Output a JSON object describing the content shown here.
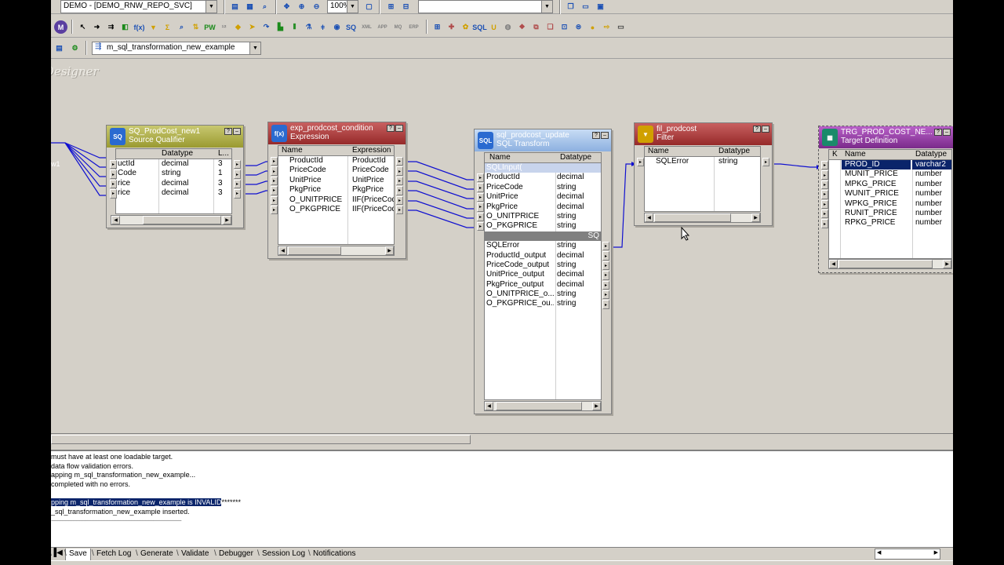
{
  "toolbar": {
    "repo_combo": "DEMO - [DEMO_RNW_REPO_SVC]",
    "zoom": "100%",
    "mapping_combo": "m_sql_transformation_new_example"
  },
  "canvas": {
    "designer_label": "Designer",
    "link_label": "w1"
  },
  "sq": {
    "title": "SQ_ProdCost_new1",
    "subtitle": "Source Qualifier",
    "headers": [
      "",
      "Datatype",
      "L..."
    ],
    "rows": [
      [
        "uctId",
        "decimal",
        "3"
      ],
      [
        "Code",
        "string",
        "1"
      ],
      [
        "rice",
        "decimal",
        "3"
      ],
      [
        "rice",
        "decimal",
        "3"
      ]
    ]
  },
  "exp": {
    "title": "exp_prodcost_condition",
    "subtitle": "Expression",
    "headers": [
      "Name",
      "Expression"
    ],
    "rows": [
      [
        "ProductId",
        "ProductId"
      ],
      [
        "PriceCode",
        "PriceCode"
      ],
      [
        "UnitPrice",
        "UnitPrice"
      ],
      [
        "PkgPrice",
        "PkgPrice"
      ],
      [
        "O_UNITPRICE",
        "IIF(PriceCode"
      ],
      [
        "O_PKGPRICE",
        "IIF(PriceCode"
      ]
    ]
  },
  "sqlt": {
    "title": "sql_prodcost_update",
    "subtitle": "SQL Transform",
    "headers": [
      "Name",
      "Datatype"
    ],
    "group_input": "SQLInput(",
    "input_rows": [
      [
        "ProductId",
        "decimal"
      ],
      [
        "PriceCode",
        "string"
      ],
      [
        "UnitPrice",
        "decimal"
      ],
      [
        "PkgPrice",
        "decimal"
      ],
      [
        "O_UNITPRICE",
        "string"
      ],
      [
        "O_PKGPRICE",
        "string"
      ]
    ],
    "group_output": "SQ",
    "output_rows": [
      [
        "SQLError",
        "string"
      ],
      [
        "ProductId_output",
        "decimal"
      ],
      [
        "PriceCode_output",
        "string"
      ],
      [
        "UnitPrice_output",
        "decimal"
      ],
      [
        "PkgPrice_output",
        "decimal"
      ],
      [
        "O_UNITPRICE_o...",
        "string"
      ],
      [
        "O_PKGPRICE_ou...",
        "string"
      ]
    ]
  },
  "flt": {
    "title": "fil_prodcost",
    "subtitle": "Filter",
    "headers": [
      "Name",
      "Datatype"
    ],
    "rows": [
      [
        "SQLError",
        "string"
      ]
    ]
  },
  "tgt": {
    "title": "TRG_PROD_COST_NE...",
    "subtitle": "Target Definition",
    "headers": [
      "K",
      "Name",
      "Datatype"
    ],
    "rows": [
      [
        "PROD_ID",
        "varchar2"
      ],
      [
        "MUNIT_PRICE",
        "number"
      ],
      [
        "MPKG_PRICE",
        "number"
      ],
      [
        "WUNIT_PRICE",
        "number"
      ],
      [
        "WPKG_PRICE",
        "number"
      ],
      [
        "RUNIT_PRICE",
        "number"
      ],
      [
        "RPKG_PRICE",
        "number"
      ]
    ]
  },
  "output": {
    "lines": [
      "must have at least one loadable target.",
      "data flow validation errors.",
      "apping m_sql_transformation_new_example...",
      "completed with no errors.",
      "",
      "pping m_sql_transformation_new_example is INVALID",
      "_sql_transformation_new_example inserted.",
      "-----------------------------------------------------------------------------------"
    ],
    "highlight_suffix": "*******"
  },
  "tabs": [
    "Save",
    "Fetch Log",
    "Generate",
    "Validate",
    "Debugger",
    "Session Log",
    "Notifications"
  ],
  "colors": {
    "sq_header": "#b0b04a",
    "exp_header": "#b04a4a",
    "sql_header": "#a8c4e8",
    "flt_header": "#b04a4a",
    "tgt_header": "#9a3fa8",
    "link": "#1010d0"
  }
}
